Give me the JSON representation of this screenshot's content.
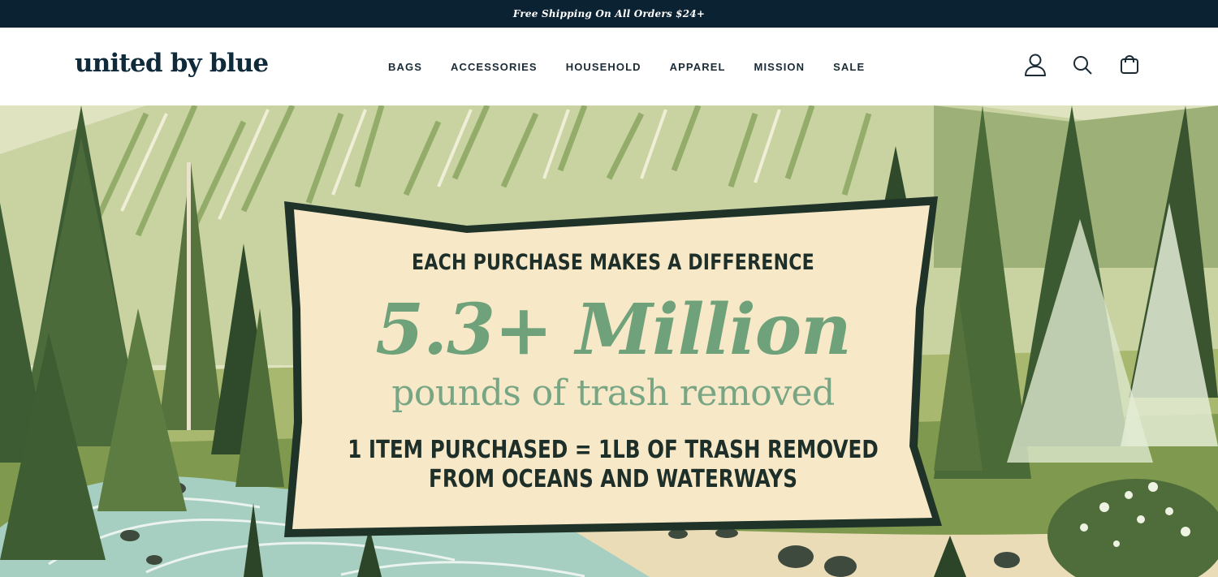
{
  "announcement": {
    "text": "Free Shipping On All Orders $24+"
  },
  "header": {
    "logo": "united by blue",
    "nav": [
      "BAGS",
      "ACCESSORIES",
      "HOUSEHOLD",
      "APPAREL",
      "MISSION",
      "SALE"
    ],
    "icons": [
      "account-icon",
      "search-icon",
      "cart-icon"
    ]
  },
  "hero": {
    "eyebrow": "EACH PURCHASE MAKES A DIFFERENCE",
    "headline": "5.3+ Million",
    "subheadline": "pounds of trash removed",
    "tagline_line1": "1 ITEM PURCHASED = 1LB OF TRASH REMOVED",
    "tagline_line2": "FROM OCEANS AND WATERWAYS"
  },
  "colors": {
    "announcement_bg": "#0b2233",
    "logo": "#0f2a3b",
    "headline_green": "#6fa27a",
    "panel_bg": "#f7e9c8",
    "panel_border": "#1f3329"
  }
}
